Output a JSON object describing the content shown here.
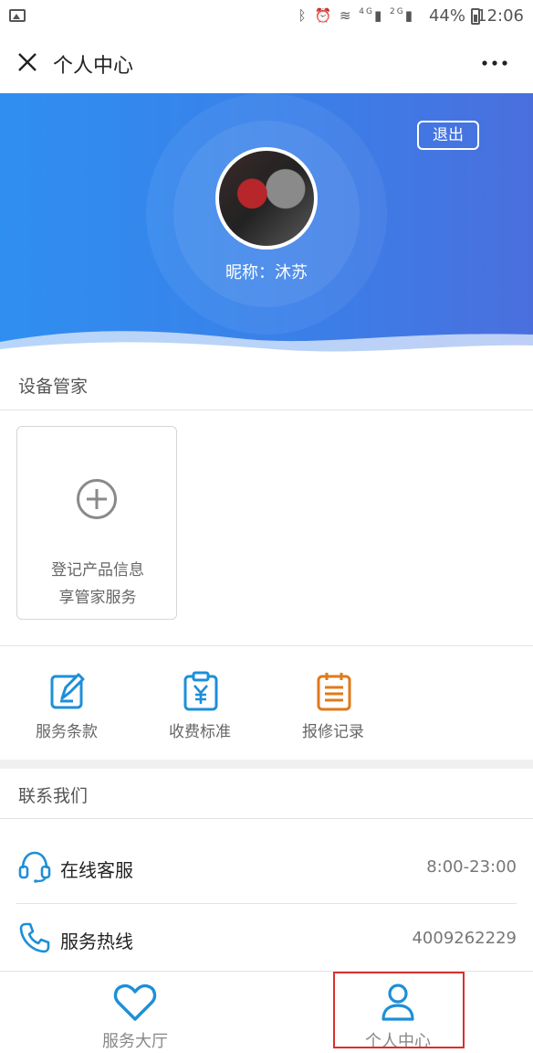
{
  "status_bar": {
    "battery": "44%",
    "time": "12:06",
    "icons": [
      "bluetooth-icon",
      "alarm-icon",
      "wifi-icon",
      "signal-4g-icon",
      "signal-2g-icon"
    ],
    "signal_4g": "4G",
    "signal_2g": "2G"
  },
  "header": {
    "title": "个人中心"
  },
  "profile": {
    "logout_label": "退出",
    "nickname": "昵称：沐苏"
  },
  "device_manager": {
    "title": "设备管家",
    "card_line1": "登记产品信息",
    "card_line2": "享管家服务"
  },
  "quick_actions": [
    {
      "label": "服务条款",
      "icon": "edit-document-icon"
    },
    {
      "label": "收费标准",
      "icon": "yuan-clipboard-icon"
    },
    {
      "label": "报修记录",
      "icon": "repair-record-icon"
    }
  ],
  "contact": {
    "title": "联系我们",
    "online_service": {
      "label": "在线客服",
      "value": "8:00-23:00"
    },
    "hotline": {
      "label": "服务热线",
      "value": "4009262229"
    }
  },
  "bottom_nav": {
    "items": [
      {
        "label": "服务大厅",
        "icon": "heart-icon",
        "active": false
      },
      {
        "label": "个人中心",
        "icon": "user-icon",
        "active": true
      }
    ]
  },
  "colors": {
    "accent": "#2f8ff0",
    "icon_blue": "#1d8fd8",
    "icon_orange": "#e07a1a",
    "highlight_red": "#d9302e"
  }
}
